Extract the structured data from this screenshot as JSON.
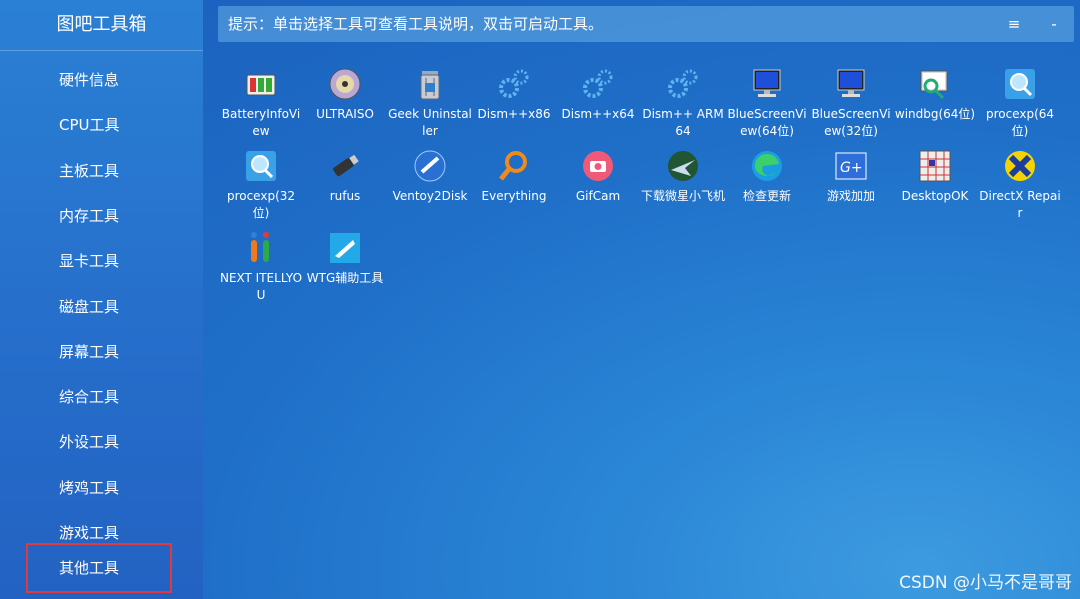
{
  "app": {
    "title": "图吧工具箱"
  },
  "sidebar": {
    "items": [
      {
        "label": "硬件信息"
      },
      {
        "label": "CPU工具"
      },
      {
        "label": "主板工具"
      },
      {
        "label": "内存工具"
      },
      {
        "label": "显卡工具"
      },
      {
        "label": "磁盘工具"
      },
      {
        "label": "屏幕工具"
      },
      {
        "label": "综合工具"
      },
      {
        "label": "外设工具"
      },
      {
        "label": "烤鸡工具"
      },
      {
        "label": "游戏工具"
      },
      {
        "label": "其他工具",
        "selected": true
      }
    ]
  },
  "hint": {
    "text": "提示：单击选择工具可查看工具说明，双击可启动工具。",
    "menu_label": "≡",
    "minimize_label": "-"
  },
  "tools": [
    {
      "label": "BatteryInfoView",
      "icon": "battery-icon"
    },
    {
      "label": "ULTRAISO",
      "icon": "disc-icon"
    },
    {
      "label": "Geek Uninstaller",
      "icon": "trash-can-icon"
    },
    {
      "label": "Dism++x86",
      "icon": "gears-icon"
    },
    {
      "label": "Dism++x64",
      "icon": "gears-icon"
    },
    {
      "label": "Dism++ ARM64",
      "icon": "gears-icon"
    },
    {
      "label": "BlueScreenView(64位)",
      "icon": "monitor-icon"
    },
    {
      "label": "BlueScreenView(32位)",
      "icon": "monitor-icon"
    },
    {
      "label": "windbg(64位)",
      "icon": "debugger-icon"
    },
    {
      "label": "procexp(64位)",
      "icon": "magnifier-icon"
    },
    {
      "label": "procexp(32位)",
      "icon": "magnifier-icon"
    },
    {
      "label": "rufus",
      "icon": "usb-drive-icon"
    },
    {
      "label": "Ventoy2Disk",
      "icon": "ventoy-icon"
    },
    {
      "label": "Everything",
      "icon": "search-icon"
    },
    {
      "label": "GifCam",
      "icon": "camera-icon"
    },
    {
      "label": "下载微星小飞机",
      "icon": "afterburner-icon"
    },
    {
      "label": "检查更新",
      "icon": "edge-icon"
    },
    {
      "label": "游戏加加",
      "icon": "game-plus-icon"
    },
    {
      "label": "DesktopOK",
      "icon": "grid-icon"
    },
    {
      "label": "DirectX Repair",
      "icon": "directx-icon"
    },
    {
      "label": "NEXT ITELLYOU",
      "icon": "itellyou-icon"
    },
    {
      "label": "WTG辅助工具",
      "icon": "wtg-icon"
    }
  ],
  "watermark": "CSDN @小马不是哥哥",
  "colors": {
    "selected_border": "#e23a3a",
    "accent": "#2670cc"
  }
}
